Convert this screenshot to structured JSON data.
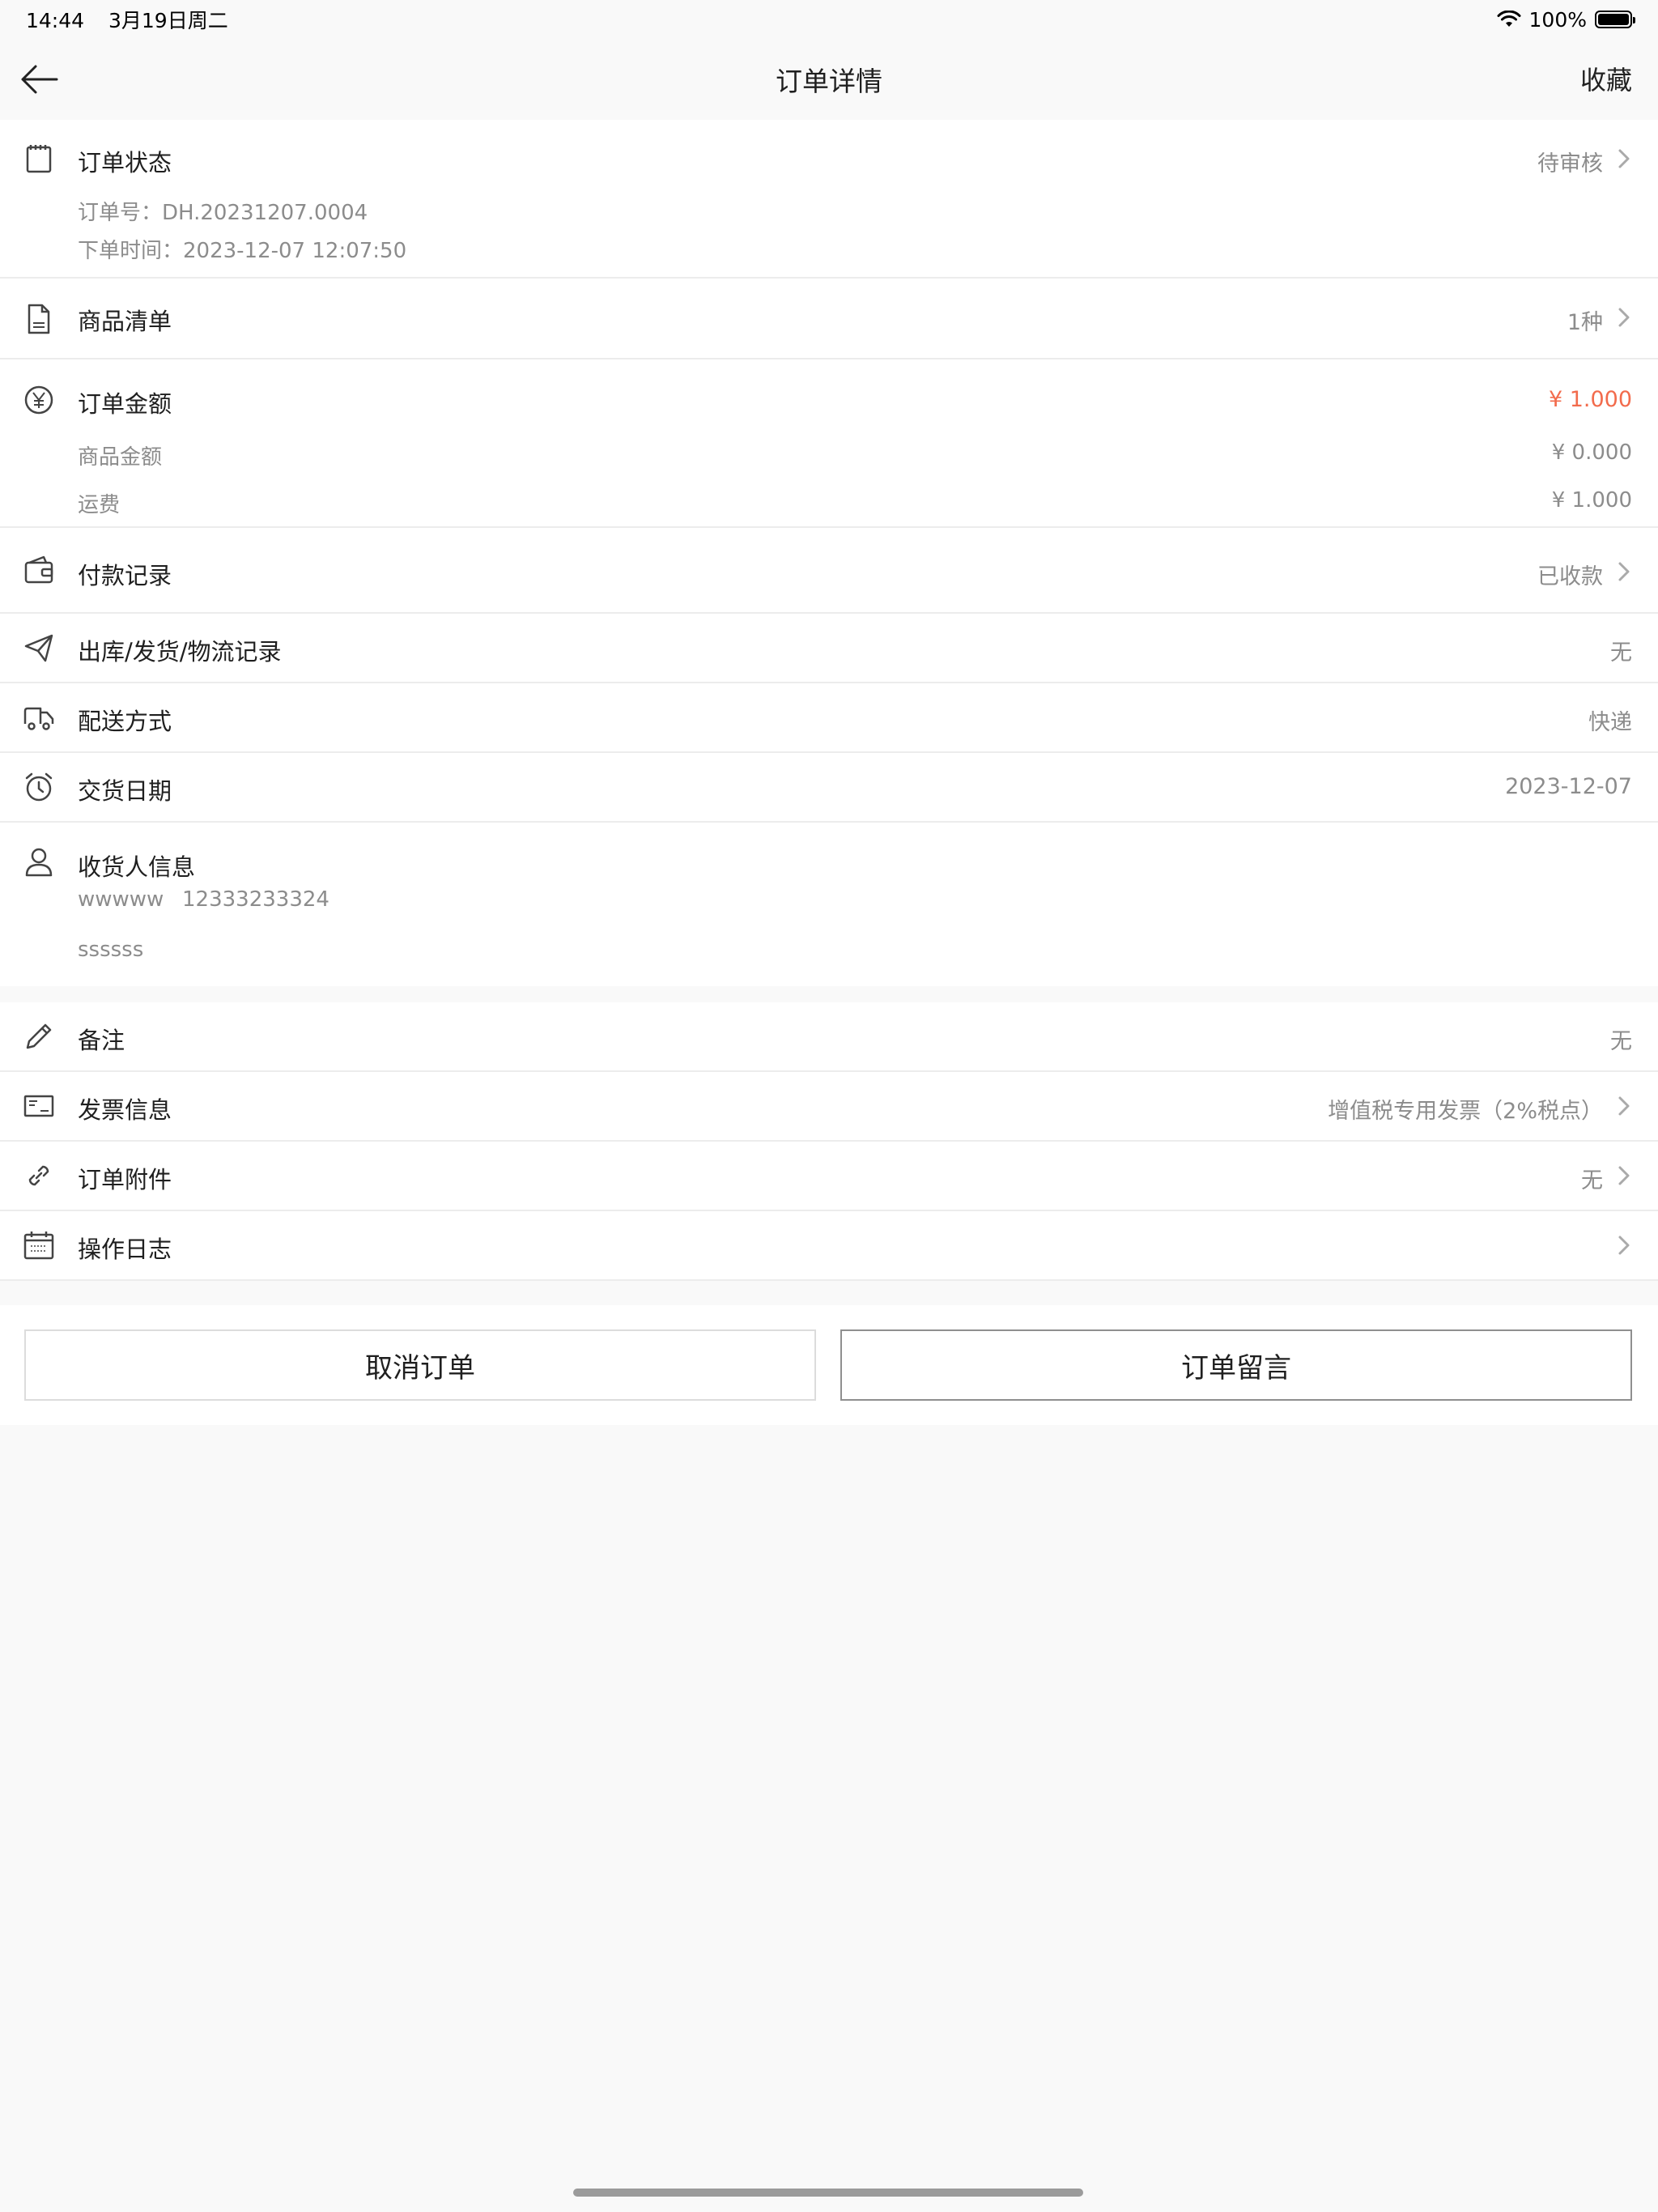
{
  "status_bar": {
    "time": "14:44",
    "date": "3月19日周二",
    "battery": "100%"
  },
  "nav": {
    "title": "订单详情",
    "right_action": "收藏"
  },
  "order_status": {
    "title": "订单状态",
    "value": "待审核",
    "order_no": "订单号：DH.20231207.0004",
    "order_time": "下单时间：2023-12-07 12:07:50"
  },
  "goods_list": {
    "title": "商品清单",
    "value": "1种"
  },
  "order_amount": {
    "title": "订单金额",
    "value": "¥ 1.000",
    "goods_amount_label": "商品金额",
    "goods_amount_value": "¥ 0.000",
    "shipping_label": "运费",
    "shipping_value": "¥ 1.000"
  },
  "payment": {
    "title": "付款记录",
    "value": "已收款"
  },
  "logistics": {
    "title": "出库/发货/物流记录",
    "value": "无"
  },
  "delivery_method": {
    "title": "配送方式",
    "value": "快递"
  },
  "delivery_date": {
    "title": "交货日期",
    "value": "2023-12-07"
  },
  "receiver": {
    "title": "收货人信息",
    "name": "wwwww",
    "phone": "12333233324",
    "address": "ssssss"
  },
  "remark": {
    "title": "备注",
    "value": "无"
  },
  "invoice": {
    "title": "发票信息",
    "value": "增值税专用发票（2%税点）"
  },
  "attachment": {
    "title": "订单附件",
    "value": "无"
  },
  "log": {
    "title": "操作日志"
  },
  "buttons": {
    "cancel": "取消订单",
    "message": "订单留言"
  },
  "colors": {
    "accent": "#f26b4c",
    "background": "#f9f9f9"
  }
}
